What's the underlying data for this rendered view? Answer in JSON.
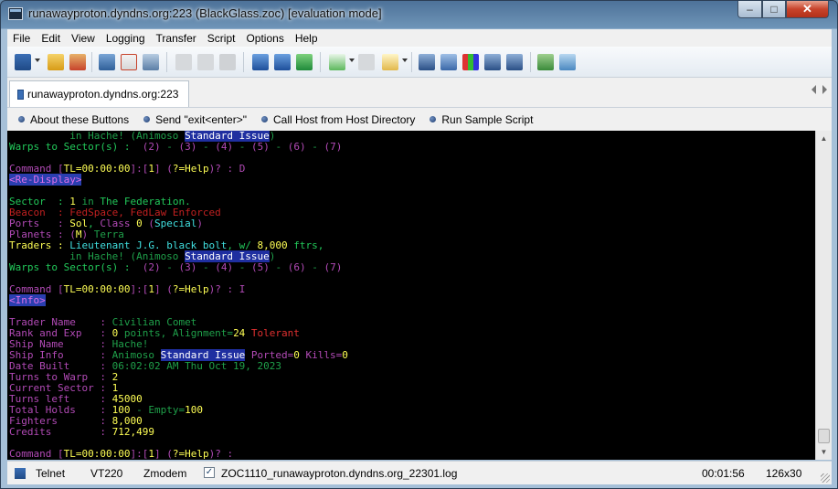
{
  "window": {
    "title": "runawayproton.dyndns.org:223 (BlackGlass.zoc) [evaluation mode]",
    "min_label": "–",
    "max_label": "□",
    "close_label": "✕"
  },
  "menu": [
    "File",
    "Edit",
    "View",
    "Logging",
    "Transfer",
    "Script",
    "Options",
    "Help"
  ],
  "session_tab": {
    "label": "runawayproton.dyndns.org:223"
  },
  "button_bar": [
    "About these Buttons",
    "Send \"exit<enter>\"",
    "Call Host from Host Directory",
    "Run Sample Script"
  ],
  "terminal": {
    "lines": [
      [
        [
          "          in Hache! (Animoso ",
          "c-dg"
        ],
        [
          "Standard Issue",
          "hl"
        ],
        [
          ")",
          "c-dg"
        ]
      ],
      [
        [
          "Warps to Sector(s) :  ",
          "c-g"
        ],
        [
          "(2)",
          "c-m"
        ],
        [
          " - ",
          "c-dg"
        ],
        [
          "(3)",
          "c-m"
        ],
        [
          " - ",
          "c-dg"
        ],
        [
          "(4)",
          "c-m"
        ],
        [
          " - ",
          "c-dg"
        ],
        [
          "(5)",
          "c-m"
        ],
        [
          " - ",
          "c-dg"
        ],
        [
          "(6)",
          "c-m"
        ],
        [
          " - ",
          "c-dg"
        ],
        [
          "(7)",
          "c-m"
        ]
      ],
      [
        [
          "",
          ""
        ]
      ],
      [
        [
          "Command [",
          "c-m"
        ],
        [
          "TL=",
          "c-y"
        ],
        [
          "00:00:00",
          "c-y"
        ],
        [
          "]:[",
          "c-m"
        ],
        [
          "1",
          "c-y"
        ],
        [
          "] (",
          "c-m"
        ],
        [
          "?=Help",
          "c-y"
        ],
        [
          ")? : D",
          "c-m"
        ]
      ],
      [
        [
          "<Re-Display>",
          "hl-m"
        ]
      ],
      [
        [
          "",
          ""
        ]
      ],
      [
        [
          "Sector  : ",
          "c-g"
        ],
        [
          "1",
          "c-y"
        ],
        [
          " in ",
          "c-dg"
        ],
        [
          "The Federation.",
          "c-g"
        ]
      ],
      [
        [
          "Beacon  : ",
          "c-dr"
        ],
        [
          "FedSpace, FedLaw Enforced",
          "c-dr"
        ]
      ],
      [
        [
          "Ports   : ",
          "c-m"
        ],
        [
          "Sol",
          "c-y"
        ],
        [
          ", ",
          "c-g"
        ],
        [
          "Class ",
          "c-m"
        ],
        [
          "0",
          "c-y"
        ],
        [
          " (",
          "c-m"
        ],
        [
          "Special",
          "c-c"
        ],
        [
          ")",
          "c-m"
        ]
      ],
      [
        [
          "Planets : ",
          "c-m"
        ],
        [
          "(",
          "c-m"
        ],
        [
          "M",
          "c-y"
        ],
        [
          ") ",
          "c-m"
        ],
        [
          "Terra",
          "c-dg"
        ]
      ],
      [
        [
          "Traders : ",
          "c-y"
        ],
        [
          "Lieutenant J.G. black bolt",
          "c-c"
        ],
        [
          ", w/ ",
          "c-g"
        ],
        [
          "8,000",
          "c-y"
        ],
        [
          " ftrs,",
          "c-g"
        ]
      ],
      [
        [
          "          in Hache! (Animoso ",
          "c-dg"
        ],
        [
          "Standard Issue",
          "hl"
        ],
        [
          ")",
          "c-dg"
        ]
      ],
      [
        [
          "Warps to Sector(s) :  ",
          "c-g"
        ],
        [
          "(2)",
          "c-m"
        ],
        [
          " - ",
          "c-dg"
        ],
        [
          "(3)",
          "c-m"
        ],
        [
          " - ",
          "c-dg"
        ],
        [
          "(4)",
          "c-m"
        ],
        [
          " - ",
          "c-dg"
        ],
        [
          "(5)",
          "c-m"
        ],
        [
          " - ",
          "c-dg"
        ],
        [
          "(6)",
          "c-m"
        ],
        [
          " - ",
          "c-dg"
        ],
        [
          "(7)",
          "c-m"
        ]
      ],
      [
        [
          "",
          ""
        ]
      ],
      [
        [
          "Command [",
          "c-m"
        ],
        [
          "TL=",
          "c-y"
        ],
        [
          "00:00:00",
          "c-y"
        ],
        [
          "]:[",
          "c-m"
        ],
        [
          "1",
          "c-y"
        ],
        [
          "] (",
          "c-m"
        ],
        [
          "?=Help",
          "c-y"
        ],
        [
          ")? : I",
          "c-m"
        ]
      ],
      [
        [
          "<Info>",
          "hl-m"
        ]
      ],
      [
        [
          "",
          ""
        ]
      ],
      [
        [
          "Trader Name    : ",
          "c-m"
        ],
        [
          "Civilian Comet",
          "c-dg"
        ]
      ],
      [
        [
          "Rank and Exp   : ",
          "c-m"
        ],
        [
          "0",
          "c-y"
        ],
        [
          " points, ",
          "c-dg"
        ],
        [
          "Alignment=",
          "c-dg"
        ],
        [
          "24",
          "c-y"
        ],
        [
          " Tolerant",
          "c-r"
        ]
      ],
      [
        [
          "Ship Name      : ",
          "c-m"
        ],
        [
          "Hache!",
          "c-dg"
        ]
      ],
      [
        [
          "Ship Info      : ",
          "c-m"
        ],
        [
          "Animoso ",
          "c-dg"
        ],
        [
          "Standard Issue",
          "hl"
        ],
        [
          " Ported=",
          "c-m"
        ],
        [
          "0",
          "c-y"
        ],
        [
          " Kills=",
          "c-m"
        ],
        [
          "0",
          "c-y"
        ]
      ],
      [
        [
          "Date Built     : ",
          "c-m"
        ],
        [
          "06:02:02 AM Thu Oct 19, 2023",
          "c-dg"
        ]
      ],
      [
        [
          "Turns to Warp  : ",
          "c-m"
        ],
        [
          "2",
          "c-y"
        ]
      ],
      [
        [
          "Current Sector : ",
          "c-m"
        ],
        [
          "1",
          "c-y"
        ]
      ],
      [
        [
          "Turns left     : ",
          "c-m"
        ],
        [
          "45000",
          "c-y"
        ]
      ],
      [
        [
          "Total Holds    : ",
          "c-m"
        ],
        [
          "100",
          "c-y"
        ],
        [
          " - ",
          "c-dg"
        ],
        [
          "Empty",
          "c-dg"
        ],
        [
          "=",
          "c-dg"
        ],
        [
          "100",
          "c-y"
        ]
      ],
      [
        [
          "Fighters       : ",
          "c-m"
        ],
        [
          "8,000",
          "c-y"
        ]
      ],
      [
        [
          "Credits        : ",
          "c-m"
        ],
        [
          "712,499",
          "c-y"
        ]
      ],
      [
        [
          "",
          ""
        ]
      ],
      [
        [
          "Command [",
          "c-m"
        ],
        [
          "TL=",
          "c-y"
        ],
        [
          "00:00:00",
          "c-y"
        ],
        [
          "]:[",
          "c-m"
        ],
        [
          "1",
          "c-y"
        ],
        [
          "] (",
          "c-m"
        ],
        [
          "?=Help",
          "c-y"
        ],
        [
          ")? :",
          "c-m"
        ]
      ]
    ]
  },
  "status": {
    "protocol": "Telnet",
    "emulation": "VT220",
    "transfer": "Zmodem",
    "log_checked_mark": "✓",
    "log_file": "ZOC1110_runawayproton.dyndns.org_22301.log",
    "timer": "00:01:56",
    "size": "126x30"
  },
  "colors": {
    "terminal_bg": "#000000",
    "highlight_bg": "#1f2fa0",
    "close_button": "#c7432b"
  }
}
